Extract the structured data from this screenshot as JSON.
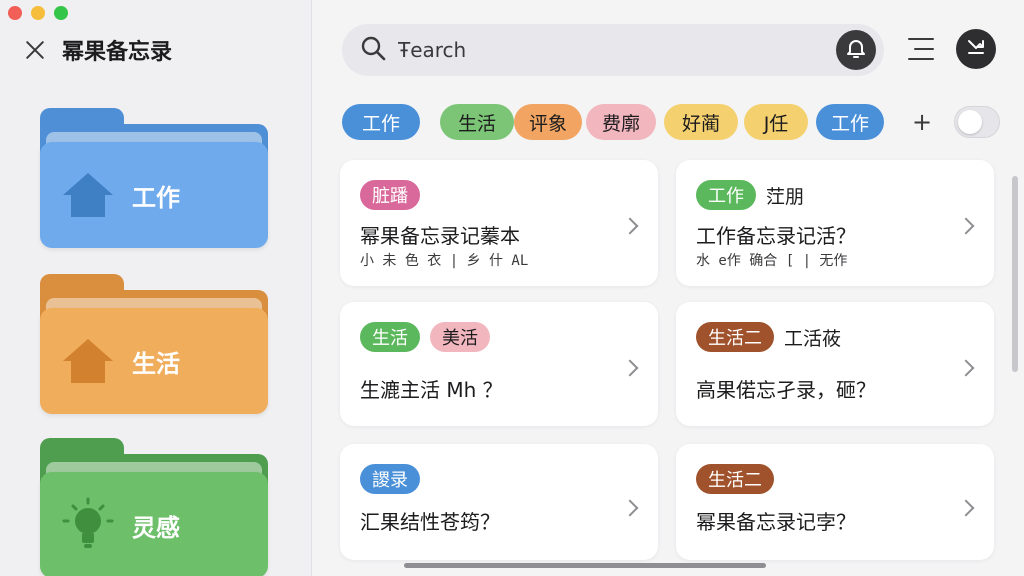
{
  "sidebar": {
    "title": "幂果备忘录",
    "folders": [
      {
        "label": "工作",
        "icon": "house-icon",
        "color": "#6fabec"
      },
      {
        "label": "生活",
        "icon": "house-icon",
        "color": "#f0ad5c"
      },
      {
        "label": "灵感",
        "icon": "lightbulb-icon",
        "color": "#6ebf6a"
      }
    ]
  },
  "search": {
    "placeholder": "Search",
    "value": "Ŧearch"
  },
  "tags": [
    {
      "label": "工作",
      "color": "#4a90d9",
      "text_color": "#ffffff"
    },
    {
      "label": "生活",
      "color": "#7cc576",
      "text_color": "#1c1c1e"
    },
    {
      "label": "评象",
      "color": "#f2a562",
      "text_color": "#1c1c1e"
    },
    {
      "label": "费廓",
      "color": "#f2b6be",
      "text_color": "#1c1c1e"
    },
    {
      "label": "好蔺",
      "color": "#f5d06e",
      "text_color": "#1c1c1e"
    },
    {
      "label": "J任",
      "color": "#f5d06e",
      "text_color": "#1c1c1e"
    },
    {
      "label": "工作",
      "color": "#4a90d9",
      "text_color": "#ffffff"
    }
  ],
  "cards": [
    {
      "tags": [
        {
          "label": "脏蹯",
          "color": "#d9699a",
          "text_color": "#ffffff"
        }
      ],
      "extra": "",
      "title": "幂果备忘录记蓁本",
      "subtitle": "小 未 色 衣        |    乡 什 AL"
    },
    {
      "tags": [
        {
          "label": "工作",
          "color": "#5cb85c",
          "text_color": "#ffffff"
        }
      ],
      "extra": "茳朋",
      "title": "工作备忘录记活？",
      "subtitle": "水  e作 确合 [    |   无作"
    },
    {
      "tags": [
        {
          "label": "生活",
          "color": "#5cb85c",
          "text_color": "#ffffff"
        },
        {
          "label": "美活",
          "color": "#f2b6be",
          "text_color": "#1c1c1e"
        }
      ],
      "extra": "",
      "title": "生漉主活 Mh ？",
      "subtitle": ""
    },
    {
      "tags": [
        {
          "label": "生活⼆",
          "color": "#a0522d",
          "text_color": "#ffffff"
        }
      ],
      "extra": "工活莜",
      "title": "高果偌忘孑录，砸？",
      "subtitle": ""
    },
    {
      "tags": [
        {
          "label": "謖录",
          "color": "#4a90d9",
          "text_color": "#ffffff"
        }
      ],
      "extra": "",
      "title": "汇果结性苍筠？",
      "subtitle": ""
    },
    {
      "tags": [
        {
          "label": "生活⼆",
          "color": "#a0522d",
          "text_color": "#ffffff"
        }
      ],
      "extra": "",
      "title": "幂果备忘录记孛？",
      "subtitle": ""
    }
  ]
}
